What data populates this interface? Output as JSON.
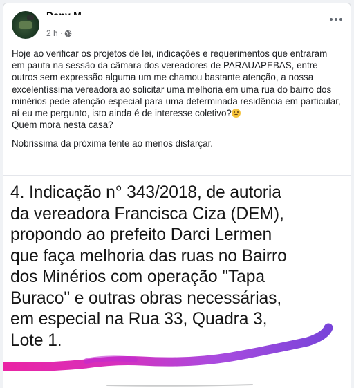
{
  "post": {
    "author": "Dany M",
    "time": "2 h",
    "separator": "·",
    "privacy_icon": "globe-icon",
    "more_icon": "more-horizontal-icon",
    "paragraphs": [
      "Hoje ao verificar os projetos de lei, indicações e requerimentos que entraram em pauta na sessão da câmara dos vereadores de PARAUAPEBAS, entre outros sem expressão alguma um me chamou bastante atenção, a nossa excelentíssima vereadora ao solicitar uma melhoria em uma rua do bairro dos minérios pede atenção especial para uma determinada residência em particular, aí eu me pergunto, isto ainda é de interesse coletivo?",
      "Quem mora nesta casa?",
      "Nobrissima da próxima tente ao menos disfarçar."
    ],
    "emoji": "unamused-face-emoji"
  },
  "image": {
    "lines": [
      "4.  Indicação n° 343/2018, de autoria",
      "da vereadora Francisca Ciza (DEM),",
      "propondo ao prefeito Darci Lermen",
      "que faça melhoria das ruas no Bairro",
      "dos Minérios com operação \"Tapa",
      "Buraco\" e outras obras necessárias,",
      "em especial na Rua 33, Quadra 3,",
      "Lote 1."
    ],
    "highlight_colors": [
      "#e8119c",
      "#a23bdc",
      "#6d34d6"
    ]
  }
}
